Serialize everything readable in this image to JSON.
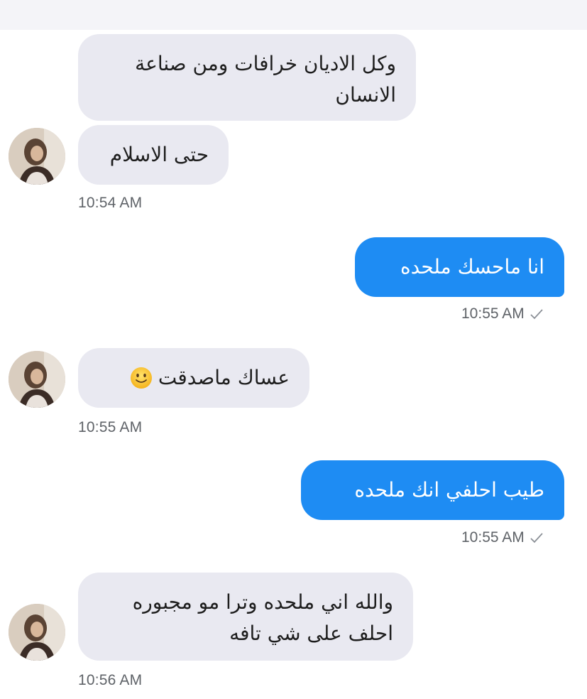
{
  "messages": [
    {
      "id": "m1",
      "direction": "incoming",
      "text": "وكل الاديان خرافات ومن صناعة\nالانسان"
    },
    {
      "id": "m2",
      "direction": "incoming",
      "text": "حتى الاسلام",
      "time": "10:54 AM"
    },
    {
      "id": "m3",
      "direction": "outgoing",
      "text": "انا ماحسك ملحده",
      "time": "10:55 AM",
      "status_icon": "check-icon"
    },
    {
      "id": "m4",
      "direction": "incoming",
      "text": "عساك ماصدقت",
      "emoji": "slightly-smiling-face-icon",
      "time": "10:55 AM"
    },
    {
      "id": "m5",
      "direction": "outgoing",
      "text": "طيب احلفي انك ملحده",
      "time": "10:55 AM",
      "status_icon": "check-icon"
    },
    {
      "id": "m6",
      "direction": "incoming",
      "text": "والله اني ملحده وترا مو مجبوره\nاحلف على شي تافه",
      "time": "10:56 AM"
    }
  ],
  "colors": {
    "incoming_bubble": "#e9e9f1",
    "outgoing_bubble": "#1e8cf3",
    "timestamp": "#5f6368",
    "header": "#f4f4f8"
  }
}
